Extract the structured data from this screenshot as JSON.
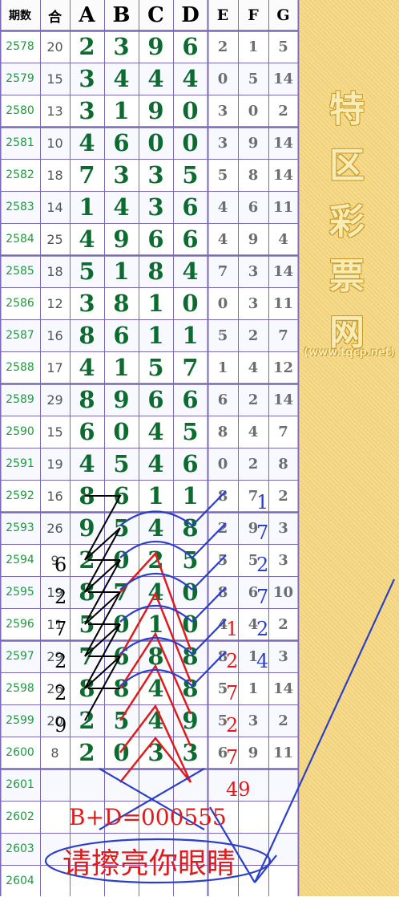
{
  "headers": {
    "id": "期数",
    "sum": "合",
    "a": "A",
    "b": "B",
    "c": "C",
    "d": "D",
    "e": "E",
    "f": "F",
    "g": "G"
  },
  "rows": [
    {
      "id": "2578",
      "sum": "20",
      "a": "2",
      "b": "3",
      "c": "9",
      "d": "6",
      "e": "2",
      "f": "1",
      "g": "5"
    },
    {
      "id": "2579",
      "sum": "15",
      "a": "3",
      "b": "4",
      "c": "4",
      "d": "4",
      "e": "0",
      "f": "5",
      "g": "14"
    },
    {
      "id": "2580",
      "sum": "13",
      "a": "3",
      "b": "1",
      "c": "9",
      "d": "0",
      "e": "3",
      "f": "0",
      "g": "2"
    },
    {
      "id": "2581",
      "sum": "10",
      "a": "4",
      "b": "6",
      "c": "0",
      "d": "0",
      "e": "3",
      "f": "9",
      "g": "14"
    },
    {
      "id": "2582",
      "sum": "18",
      "a": "7",
      "b": "3",
      "c": "3",
      "d": "5",
      "e": "5",
      "f": "8",
      "g": "14"
    },
    {
      "id": "2583",
      "sum": "14",
      "a": "1",
      "b": "4",
      "c": "3",
      "d": "6",
      "e": "4",
      "f": "6",
      "g": "11"
    },
    {
      "id": "2584",
      "sum": "25",
      "a": "4",
      "b": "9",
      "c": "6",
      "d": "6",
      "e": "4",
      "f": "9",
      "g": "4"
    },
    {
      "id": "2585",
      "sum": "18",
      "a": "5",
      "b": "1",
      "c": "8",
      "d": "4",
      "e": "7",
      "f": "3",
      "g": "14"
    },
    {
      "id": "2586",
      "sum": "12",
      "a": "3",
      "b": "8",
      "c": "1",
      "d": "0",
      "e": "0",
      "f": "3",
      "g": "11"
    },
    {
      "id": "2587",
      "sum": "16",
      "a": "8",
      "b": "6",
      "c": "1",
      "d": "1",
      "e": "5",
      "f": "2",
      "g": "7"
    },
    {
      "id": "2588",
      "sum": "17",
      "a": "4",
      "b": "1",
      "c": "5",
      "d": "7",
      "e": "1",
      "f": "4",
      "g": "12"
    },
    {
      "id": "2589",
      "sum": "29",
      "a": "8",
      "b": "9",
      "c": "6",
      "d": "6",
      "e": "6",
      "f": "2",
      "g": "14"
    },
    {
      "id": "2590",
      "sum": "15",
      "a": "6",
      "b": "0",
      "c": "4",
      "d": "5",
      "e": "8",
      "f": "4",
      "g": "7"
    },
    {
      "id": "2591",
      "sum": "19",
      "a": "4",
      "b": "5",
      "c": "4",
      "d": "6",
      "e": "0",
      "f": "2",
      "g": "8"
    },
    {
      "id": "2592",
      "sum": "16",
      "a": "8",
      "b": "6",
      "c": "1",
      "d": "1",
      "e": "8",
      "f": "7",
      "g": "2"
    },
    {
      "id": "2593",
      "sum": "26",
      "a": "9",
      "b": "5",
      "c": "4",
      "d": "8",
      "e": "2",
      "f": "9",
      "g": "3"
    },
    {
      "id": "2594",
      "sum": "9",
      "a": "2",
      "b": "0",
      "c": "2",
      "d": "5",
      "e": "5",
      "f": "5",
      "g": "3"
    },
    {
      "id": "2595",
      "sum": "19",
      "a": "8",
      "b": "7",
      "c": "4",
      "d": "0",
      "e": "8",
      "f": "6",
      "g": "10"
    },
    {
      "id": "2596",
      "sum": "11",
      "a": "5",
      "b": "0",
      "c": "1",
      "d": "0",
      "e": "4",
      "f": "4",
      "g": "2"
    },
    {
      "id": "2597",
      "sum": "29",
      "a": "7",
      "b": "6",
      "c": "8",
      "d": "8",
      "e": "8",
      "f": "1",
      "g": "3"
    },
    {
      "id": "2598",
      "sum": "26",
      "a": "8",
      "b": "8",
      "c": "4",
      "d": "8",
      "e": "5",
      "f": "1",
      "g": "14"
    },
    {
      "id": "2599",
      "sum": "20",
      "a": "2",
      "b": "5",
      "c": "4",
      "d": "9",
      "e": "5",
      "f": "3",
      "g": "2"
    },
    {
      "id": "2600",
      "sum": "8",
      "a": "2",
      "b": "0",
      "c": "3",
      "d": "3",
      "e": "6",
      "f": "9",
      "g": "11"
    },
    {
      "id": "2601",
      "sum": "",
      "a": "",
      "b": "",
      "c": "",
      "d": "",
      "e": "",
      "f": "",
      "g": ""
    },
    {
      "id": "2602",
      "sum": "",
      "a": "",
      "b": "",
      "c": "",
      "d": "",
      "e": "",
      "f": "",
      "g": ""
    },
    {
      "id": "2603",
      "sum": "",
      "a": "",
      "b": "",
      "c": "",
      "d": "",
      "e": "",
      "f": "",
      "g": ""
    },
    {
      "id": "2604",
      "sum": "",
      "a": "",
      "b": "",
      "c": "",
      "d": "",
      "e": "",
      "f": "",
      "g": ""
    }
  ],
  "sidebar": {
    "chars": [
      "特",
      "区",
      "彩",
      "票",
      "网"
    ],
    "site": "(www.tqcp.net)"
  },
  "annotations": {
    "black_digits": [
      "6",
      "2",
      "7",
      "2",
      "2",
      "9"
    ],
    "blue_digits": [
      "1",
      "7",
      "2",
      "7",
      "2",
      "4"
    ],
    "red_digits": [
      "1",
      "2",
      "7",
      "2",
      "7"
    ],
    "red_number": "49",
    "formula": "B+D=000555",
    "slogan": "请擦亮你眼睛"
  },
  "colors": {
    "grid_line": "#7b68b8",
    "id_text": "#1e9a3c",
    "main_digits": "#0c6b2f",
    "annot_black": "#000000",
    "annot_red": "#e01b1b",
    "annot_blue": "#2c3fc9",
    "sidebar_bg": "#f4d683"
  }
}
